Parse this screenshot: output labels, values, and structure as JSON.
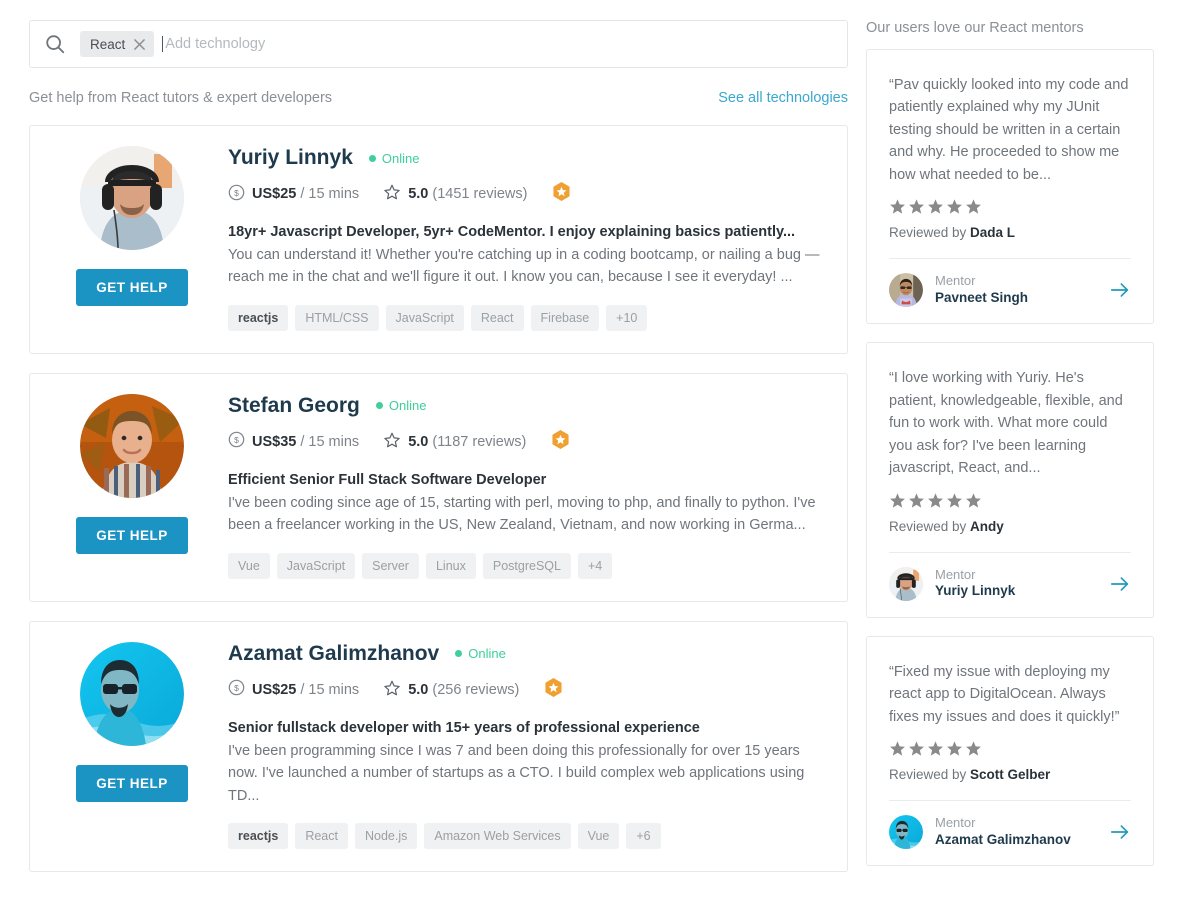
{
  "search": {
    "icon": "search-icon",
    "chip_label": "React",
    "chip_remove_icon": "close-icon",
    "placeholder": "Add technology",
    "value": ""
  },
  "subheader": {
    "text": "Get help from React tutors & expert developers",
    "see_all_label": "See all technologies",
    "link_color": "#3aa8ce"
  },
  "colors": {
    "primary_button": "#1b94c4",
    "online_green": "#3ecf9a",
    "badge_orange": "#f0a030",
    "star_gray": "#8a8a8a",
    "arrow_teal": "#2299bb",
    "name_navy": "#1e3a4c"
  },
  "mentors": [
    {
      "name": "Yuriy Linnyk",
      "status": "Online",
      "price": "US$25",
      "price_unit": "/ 15 mins",
      "rating": "5.0",
      "reviews": "(1451 reviews)",
      "has_badge": true,
      "title": "18yr+ Javascript Developer, 5yr+ CodeMentor. I enjoy explaining basics patiently...",
      "description": "You can understand it! Whether you're catching up in a coding bootcamp, or nailing a bug — reach me in the chat and we'll figure it out. I know you can, because I see it everyday! ...",
      "button_label": "GET HELP",
      "tags": [
        "reactjs",
        "HTML/CSS",
        "JavaScript",
        "React",
        "Firebase",
        "+10"
      ],
      "active_tag_index": 0,
      "avatar": "yuriy"
    },
    {
      "name": "Stefan Georg",
      "status": "Online",
      "price": "US$35",
      "price_unit": "/ 15 mins",
      "rating": "5.0",
      "reviews": "(1187 reviews)",
      "has_badge": true,
      "title": "Efficient Senior Full Stack Software Developer",
      "description": "I've been coding since age of 15, starting with perl, moving to php, and finally to python. I've been a freelancer working in the US, New Zealand, Vietnam, and now working in Germa...",
      "button_label": "GET HELP",
      "tags": [
        "Vue",
        "JavaScript",
        "Server",
        "Linux",
        "PostgreSQL",
        "+4"
      ],
      "active_tag_index": -1,
      "avatar": "stefan"
    },
    {
      "name": "Azamat Galimzhanov",
      "status": "Online",
      "price": "US$25",
      "price_unit": "/ 15 mins",
      "rating": "5.0",
      "reviews": "(256 reviews)",
      "has_badge": true,
      "title": "Senior fullstack developer with 15+ years of professional experience",
      "description": "I've been programming since I was 7 and been doing this professionally for over 15 years now. I've launched a number of startups as a CTO. I build complex web applications using TD...",
      "button_label": "GET HELP",
      "tags": [
        "reactjs",
        "React",
        "Node.js",
        "Amazon Web Services",
        "Vue",
        "+6"
      ],
      "active_tag_index": 0,
      "avatar": "azamat"
    }
  ],
  "sidebar": {
    "title": "Our users love our React mentors",
    "testimonials": [
      {
        "quote": "“Pav quickly looked into my code and patiently explained why my JUnit testing should be written in a certain and why. He proceeded to show me how what needed to be...",
        "stars": 5,
        "reviewed_prefix": "Reviewed by ",
        "reviewer": "Dada L",
        "mentor_label": "Mentor",
        "mentor_name": "Pavneet Singh",
        "avatar": "pavneet"
      },
      {
        "quote": "“I love working with Yuriy. He's patient, knowledgeable, flexible, and fun to work with. What more could you ask for? I've been learning javascript, React, and...",
        "stars": 5,
        "reviewed_prefix": "Reviewed by ",
        "reviewer": "Andy",
        "mentor_label": "Mentor",
        "mentor_name": "Yuriy Linnyk",
        "avatar": "yuriy"
      },
      {
        "quote": "“Fixed my issue with deploying my react app to DigitalOcean. Always fixes my issues and does it quickly!”",
        "stars": 5,
        "reviewed_prefix": "Reviewed by ",
        "reviewer": "Scott Gelber",
        "mentor_label": "Mentor",
        "mentor_name": "Azamat Galimzhanov",
        "avatar": "azamat"
      }
    ]
  }
}
